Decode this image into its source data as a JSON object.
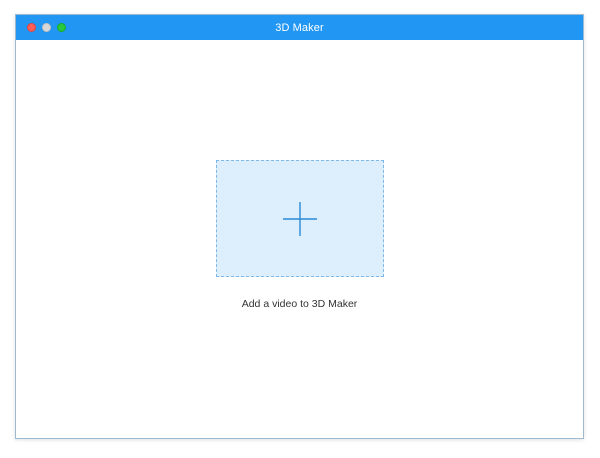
{
  "window": {
    "title": "3D Maker",
    "titlebar_color": "#2196f3",
    "traffic_lights": [
      {
        "name": "close",
        "color": "#ff5f57"
      },
      {
        "name": "minimize",
        "color": "#d8d8d8"
      },
      {
        "name": "maximize",
        "color": "#28c840"
      }
    ]
  },
  "main": {
    "dropzone": {
      "icon": "plus-icon",
      "background": "#ddeffc",
      "accent": "#2a8ad8"
    },
    "hint_text": "Add a video to 3D Maker"
  }
}
